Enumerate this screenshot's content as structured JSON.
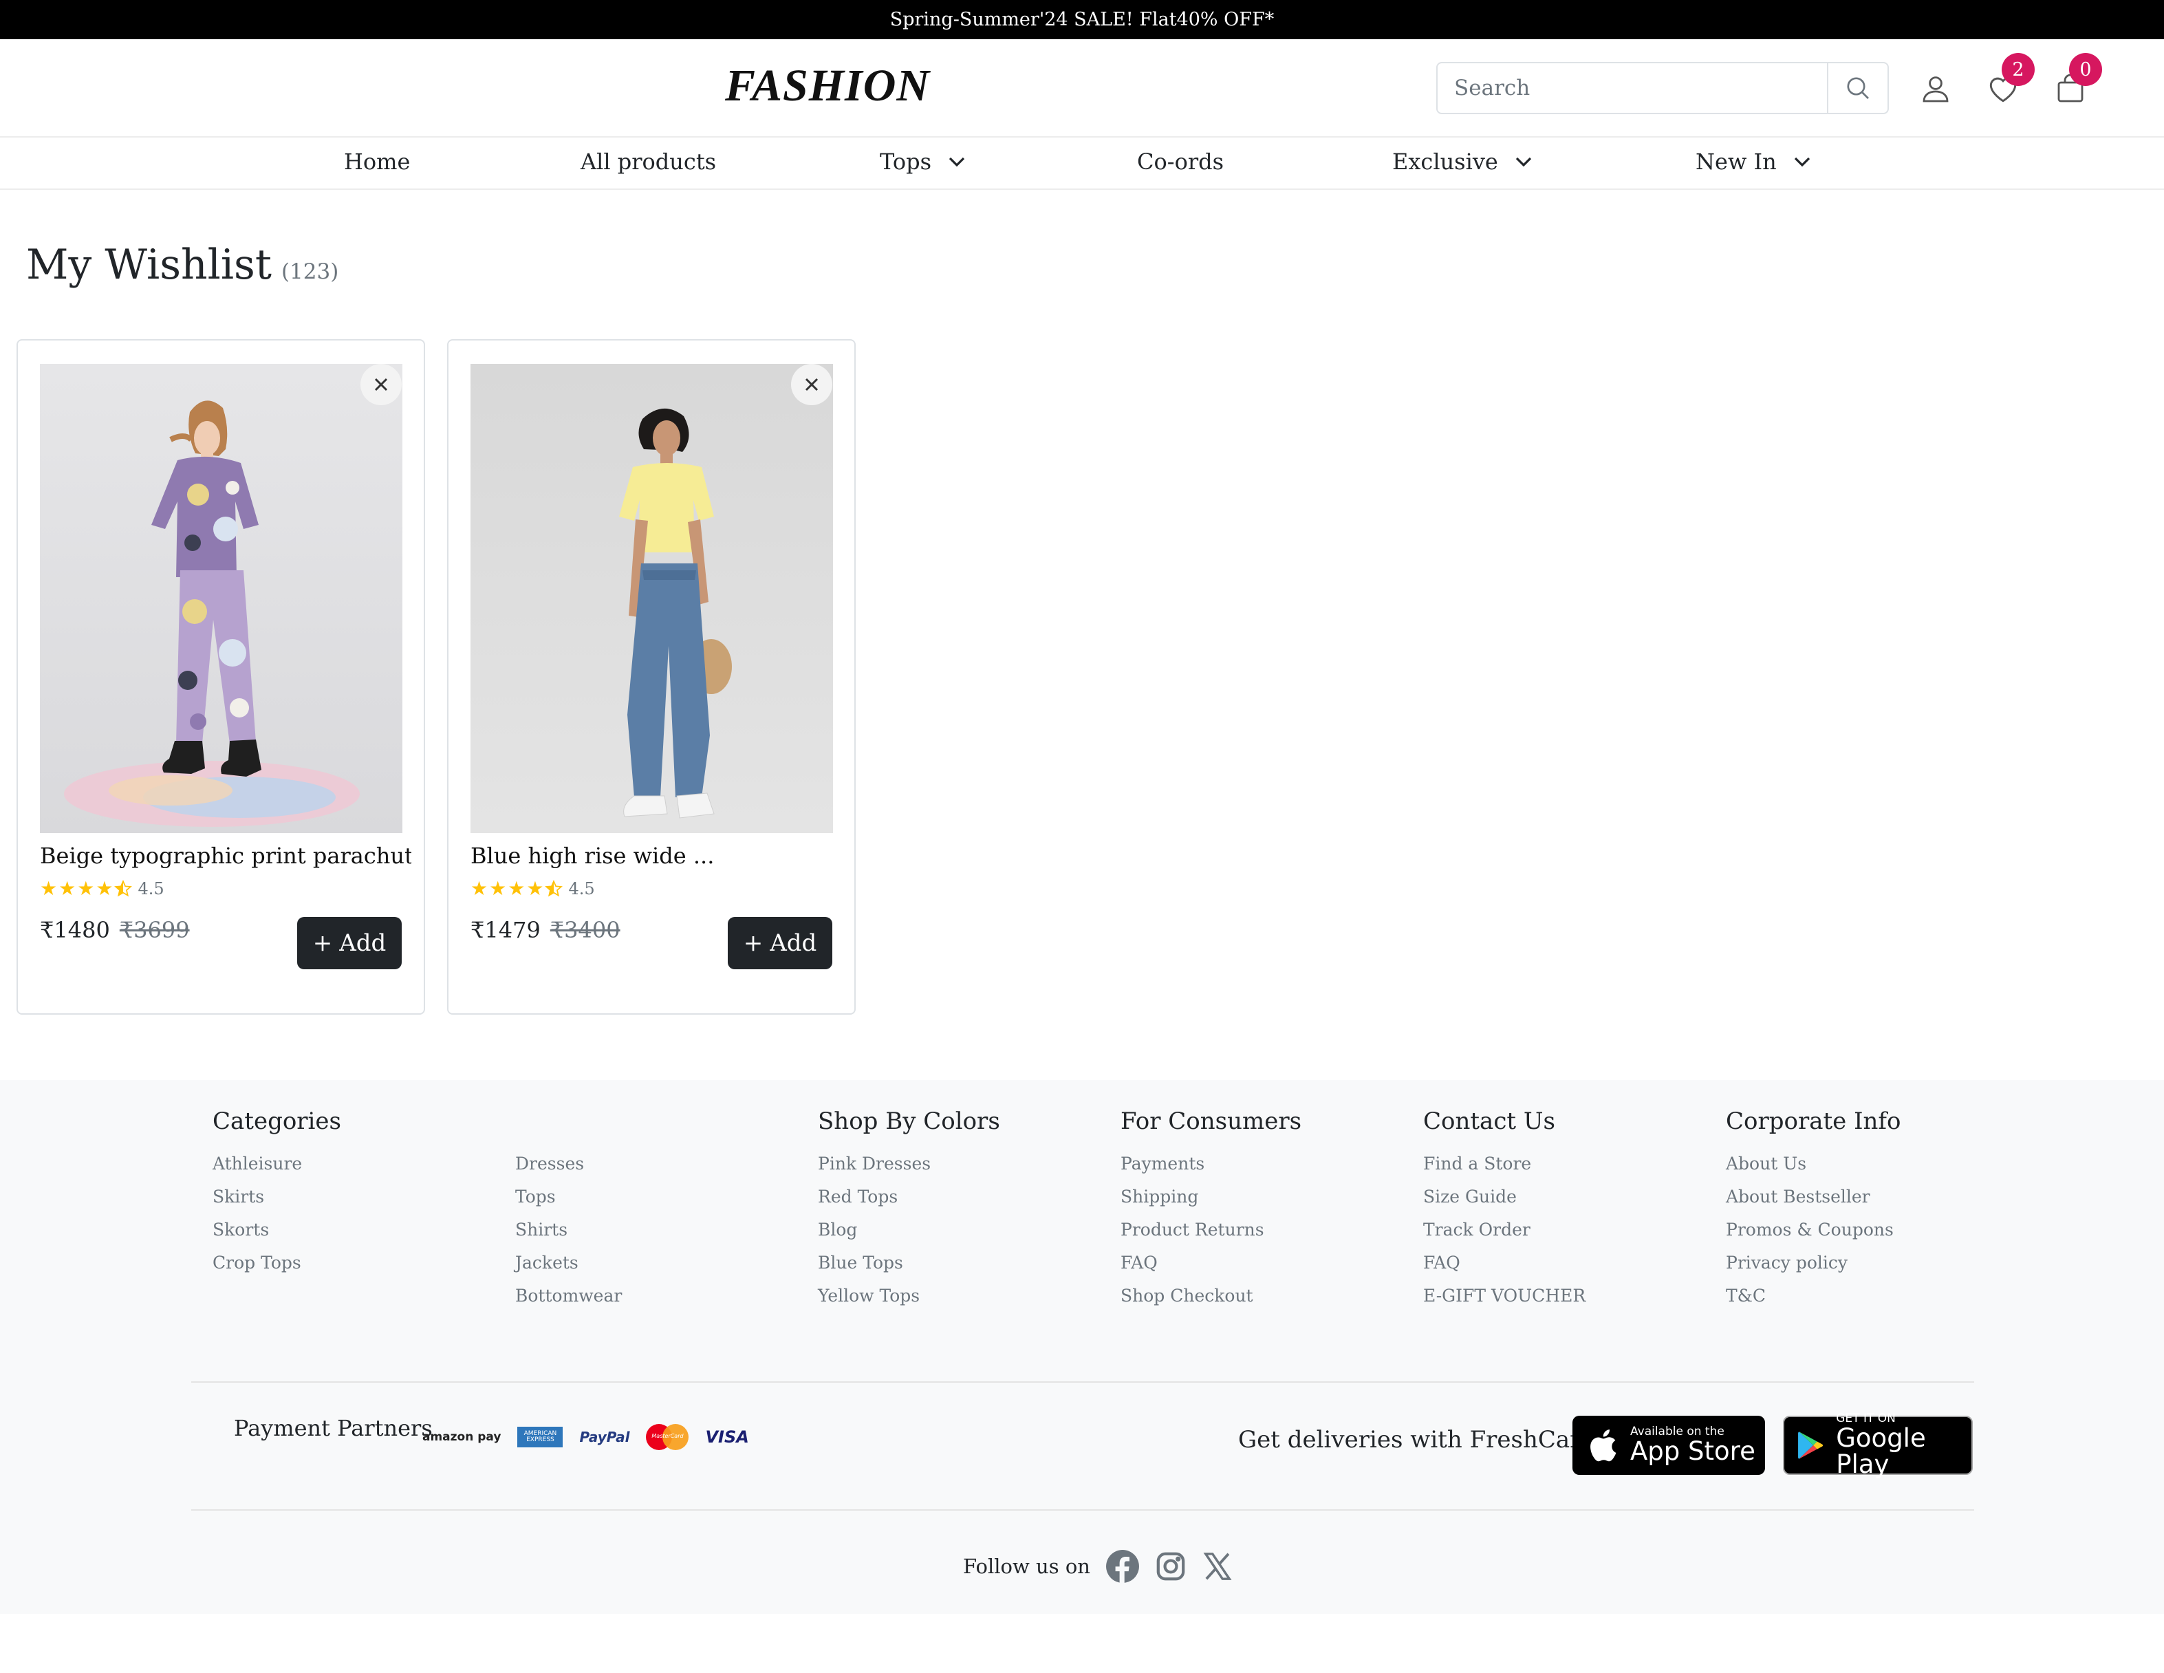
{
  "announcement": "Spring-Summer'24 SALE! Flat40% OFF*",
  "header": {
    "logo": "FASHION",
    "search_placeholder": "Search",
    "wishlist_count": "2",
    "cart_count": "0"
  },
  "nav": [
    {
      "label": "Home"
    },
    {
      "label": "All products"
    },
    {
      "label": "Tops",
      "dropdown": true
    },
    {
      "label": "Co-ords"
    },
    {
      "label": "Exclusive",
      "dropdown": true
    },
    {
      "label": "New In",
      "dropdown": true
    }
  ],
  "wishlist": {
    "title": "My Wishlist",
    "count": "(123)",
    "items": [
      {
        "name": "Beige typographic print parachute ...",
        "rating": "4.5",
        "rating_value": 4.5,
        "price": "₹1480",
        "mrp": "₹3699",
        "add_label": "Add"
      },
      {
        "name": "Blue high rise wide ...",
        "rating": "4.5",
        "rating_value": 4.5,
        "price": "₹1479",
        "mrp": "₹3400",
        "add_label": "Add"
      }
    ]
  },
  "footer": {
    "columns": [
      {
        "title": "Categories",
        "links": [
          "Athleisure",
          "Skirts",
          "Skorts",
          "Crop Tops"
        ]
      },
      {
        "title": "",
        "links": [
          "Dresses",
          "Tops",
          "Shirts",
          "Jackets",
          "Bottomwear"
        ]
      },
      {
        "title": "Shop By Colors",
        "links": [
          "Pink Dresses",
          "Red Tops",
          "Blog",
          "Blue Tops",
          "Yellow Tops"
        ]
      },
      {
        "title": "For Consumers",
        "links": [
          "Payments",
          "Shipping",
          "Product Returns",
          "FAQ",
          "Shop Checkout"
        ]
      },
      {
        "title": "Contact Us",
        "links": [
          "Find a Store",
          "Size Guide",
          "Track Order",
          "FAQ",
          "E-GIFT VOUCHER"
        ]
      },
      {
        "title": "Corporate Info",
        "links": [
          "About Us",
          "About Bestseller",
          "Promos & Coupons",
          "Privacy policy",
          "T&C"
        ]
      }
    ],
    "payment_label": "Payment Partners",
    "payment_logos": [
      "amazon pay",
      "AMERICAN EXPRESS",
      "PayPal",
      "MasterCard",
      "VISA"
    ],
    "delivery_text": "Get deliveries with FreshCart",
    "app_store": {
      "small": "Available on the",
      "big": "App Store"
    },
    "google_play": {
      "small": "GET IT ON",
      "big": "Google Play"
    },
    "follow_label": "Follow us on",
    "social_icons": [
      "facebook-icon",
      "instagram-icon",
      "x-icon"
    ]
  },
  "colors": {
    "badge": "#d6175f",
    "star": "#ffc107",
    "button": "#212529",
    "announcement_bg": "#000000"
  }
}
